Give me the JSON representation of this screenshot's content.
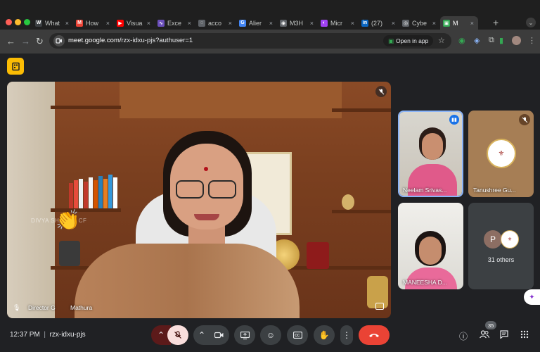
{
  "browser": {
    "tabs": [
      {
        "label": "What",
        "favicon_color": "#3c4043",
        "favicon": "W"
      },
      {
        "label": "How",
        "favicon_color": "#ea4335",
        "favicon": "M"
      },
      {
        "label": "Visua",
        "favicon_color": "#ff0000",
        "favicon": "▶"
      },
      {
        "label": "Exce",
        "favicon_color": "#6b4fbb",
        "favicon": "∿"
      },
      {
        "label": "acco",
        "favicon_color": "#5f6368",
        "favicon": "◌"
      },
      {
        "label": "Alier",
        "favicon_color": "#4285f4",
        "favicon": "G"
      },
      {
        "label": "M3H",
        "favicon_color": "#5f6368",
        "favicon": "◉"
      },
      {
        "label": "Micr",
        "favicon_color": "#a142f4",
        "favicon": "◐"
      },
      {
        "label": "(27)",
        "favicon_color": "#0a66c2",
        "favicon": "in"
      },
      {
        "label": "Cybe",
        "favicon_color": "#5f6368",
        "favicon": "◎"
      },
      {
        "label": "M",
        "favicon_color": "#34a853",
        "favicon": "▣",
        "active": true
      }
    ],
    "new_tab": "+",
    "tab_search": "⌄",
    "url_host": "meet.google.com",
    "url_path": "/rzx-idxu-pjs?authuser=1",
    "open_in_app": "Open in app"
  },
  "meeting": {
    "main_speaker_label": "Director G",
    "main_speaker_label_suffix": "Mathura",
    "background_name": "DIVYA SHARMA CF",
    "participants": [
      {
        "name": "Neelam Srivas...",
        "speaking": true
      },
      {
        "name": "Tanushree Gu...",
        "muted": true
      },
      {
        "name": "MANEESHA D..."
      }
    ],
    "others_avatar_initial": "P",
    "others_count_label": "31 others",
    "meeting_time": "12:37 PM",
    "meeting_code": "rzx-idxu-pjs",
    "separator": "|",
    "people_count": "35"
  },
  "icons": {
    "activities": "activities-icon",
    "mic_off": "mic-off-icon",
    "camera": "camera-icon",
    "present": "present-screen-icon",
    "emoji": "emoji-icon",
    "captions": "captions-icon",
    "raise_hand": "raise-hand-icon",
    "more": "more-options-icon",
    "end_call": "end-call-icon",
    "info": "info-icon",
    "people": "people-icon",
    "chat": "chat-icon",
    "apps": "apps-grid-icon"
  },
  "colors": {
    "end_call": "#ea4335",
    "active_border": "#8ab4f8",
    "activities": "#fbbc04"
  }
}
